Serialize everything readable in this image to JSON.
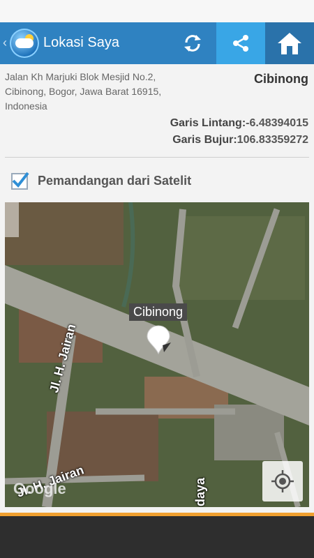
{
  "actionbar": {
    "title": "Lokasi Saya",
    "back_icon": "chevron-left-icon",
    "app_icon": "weather-app-icon",
    "refresh_icon": "refresh-icon",
    "share_icon": "share-icon",
    "home_icon": "home-icon"
  },
  "location": {
    "address": "Jalan Kh Marjuki Blok Mesjid No.2, Cibinong, Bogor, Jawa Barat 16915, Indonesia",
    "city": "Cibinong",
    "lat_label": "Garis Lintang:",
    "lat_value": "-6.48394015",
    "lon_label": "Garis Bujur:",
    "lon_value": "106.83359272"
  },
  "satellite": {
    "label": "Pemandangan dari Satelit",
    "checked": true
  },
  "map": {
    "marker_label": "Cibinong",
    "logo": "Google",
    "streets": [
      "Jl. H. Jairan",
      "Jl. H. Jairan",
      "daya"
    ]
  },
  "colors": {
    "actionbar": "#2f82c1",
    "share_highlight": "#39a6e6",
    "accent": "#f0a030"
  }
}
